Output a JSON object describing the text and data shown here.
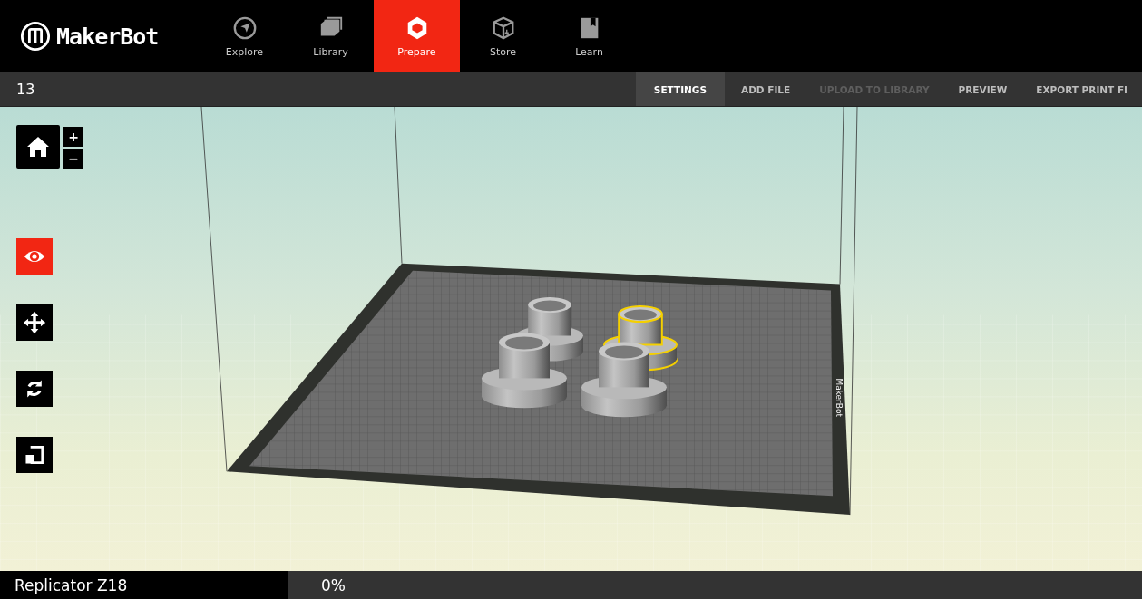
{
  "app": {
    "brand": "MakerBot"
  },
  "nav_tabs": [
    {
      "label": "Explore",
      "kind": "explore",
      "selected": false
    },
    {
      "label": "Library",
      "kind": "library",
      "selected": false
    },
    {
      "label": "Prepare",
      "kind": "prepare",
      "selected": true
    },
    {
      "label": "Store",
      "kind": "store",
      "selected": false
    },
    {
      "label": "Learn",
      "kind": "learn",
      "selected": false
    }
  ],
  "project": {
    "title": "13"
  },
  "actions": [
    {
      "label": "SETTINGS",
      "selected": true,
      "disabled": false
    },
    {
      "label": "ADD FILE",
      "selected": false,
      "disabled": false
    },
    {
      "label": "UPLOAD TO LIBRARY",
      "selected": false,
      "disabled": true
    },
    {
      "label": "PREVIEW",
      "selected": false,
      "disabled": false
    },
    {
      "label": "EXPORT PRINT FI",
      "selected": false,
      "disabled": false
    }
  ],
  "zoom_controls": [
    {
      "label": "+"
    },
    {
      "label": "−"
    }
  ],
  "tools": [
    {
      "kind": "view",
      "selected": true
    },
    {
      "kind": "move",
      "selected": false
    },
    {
      "kind": "rotate",
      "selected": false
    },
    {
      "kind": "scale",
      "selected": false
    }
  ],
  "build_plate": {
    "label": "MakerBot"
  },
  "objects": [
    {
      "selected": false
    },
    {
      "selected": true
    },
    {
      "selected": false
    },
    {
      "selected": false
    }
  ],
  "status_bar": {
    "printer": "Replicator Z18",
    "progress": "0%"
  }
}
